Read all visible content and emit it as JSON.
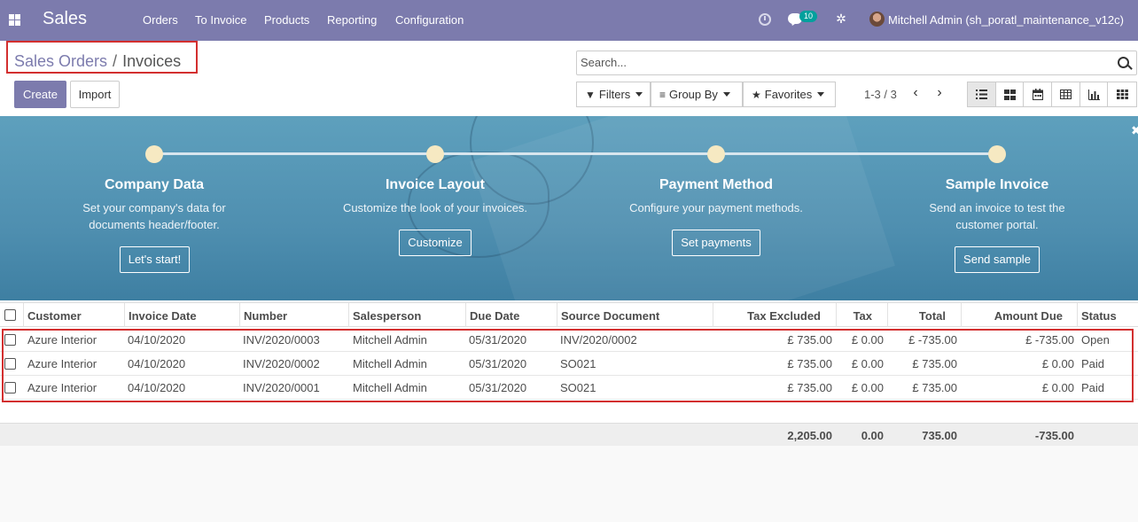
{
  "navbar": {
    "app_title": "Sales",
    "menu": [
      "Orders",
      "To Invoice",
      "Products",
      "Reporting",
      "Configuration"
    ],
    "chat_count": "10",
    "user": "Mitchell Admin (sh_poratl_maintenance_v12c)",
    "bg_color": "#7c7bad"
  },
  "breadcrumb": {
    "parent": "Sales Orders",
    "separator": "/",
    "current": "Invoices"
  },
  "buttons": {
    "create": "Create",
    "import": "Import"
  },
  "search": {
    "placeholder": "Search..."
  },
  "filters": {
    "filters": "Filters",
    "group_by": "Group By",
    "favorites": "Favorites"
  },
  "pager": {
    "label": "1-3 / 3"
  },
  "views": [
    "list-view-icon",
    "kanban-view-icon",
    "calendar-view-icon",
    "pivot-view-icon",
    "graph-view-icon",
    "grid-view-icon"
  ],
  "onboarding": {
    "steps": [
      {
        "title": "Company Data",
        "desc": [
          "Set your company's data for",
          "documents header/footer."
        ],
        "button": "Let's start!"
      },
      {
        "title": "Invoice Layout",
        "desc": [
          "Customize the look of your invoices."
        ],
        "button": "Customize"
      },
      {
        "title": "Payment Method",
        "desc": [
          "Configure your payment methods."
        ],
        "button": "Set payments"
      },
      {
        "title": "Sample Invoice",
        "desc": [
          "Send an invoice to test the",
          "customer portal."
        ],
        "button": "Send sample"
      }
    ]
  },
  "table": {
    "columns": [
      "Customer",
      "Invoice Date",
      "Number",
      "Salesperson",
      "Due Date",
      "Source Document",
      "Tax Excluded",
      "Tax",
      "Total",
      "Amount Due",
      "Status"
    ],
    "rows": [
      {
        "customer": "Azure Interior",
        "invoice_date": "04/10/2020",
        "number": "INV/2020/0003",
        "salesperson": "Mitchell Admin",
        "due_date": "05/31/2020",
        "source": "INV/2020/0002",
        "tax_excluded": "£ 735.00",
        "tax": "£ 0.00",
        "total": "£ -735.00",
        "amount_due": "£ -735.00",
        "status": "Open"
      },
      {
        "customer": "Azure Interior",
        "invoice_date": "04/10/2020",
        "number": "INV/2020/0002",
        "salesperson": "Mitchell Admin",
        "due_date": "05/31/2020",
        "source": "SO021",
        "tax_excluded": "£ 735.00",
        "tax": "£ 0.00",
        "total": "£ 735.00",
        "amount_due": "£ 0.00",
        "status": "Paid"
      },
      {
        "customer": "Azure Interior",
        "invoice_date": "04/10/2020",
        "number": "INV/2020/0001",
        "salesperson": "Mitchell Admin",
        "due_date": "05/31/2020",
        "source": "SO021",
        "tax_excluded": "£ 735.00",
        "tax": "£ 0.00",
        "total": "£ 735.00",
        "amount_due": "£ 0.00",
        "status": "Paid"
      }
    ],
    "totals": {
      "tax_excluded": "2,205.00",
      "tax": "0.00",
      "total": "735.00",
      "amount_due": "-735.00"
    }
  }
}
